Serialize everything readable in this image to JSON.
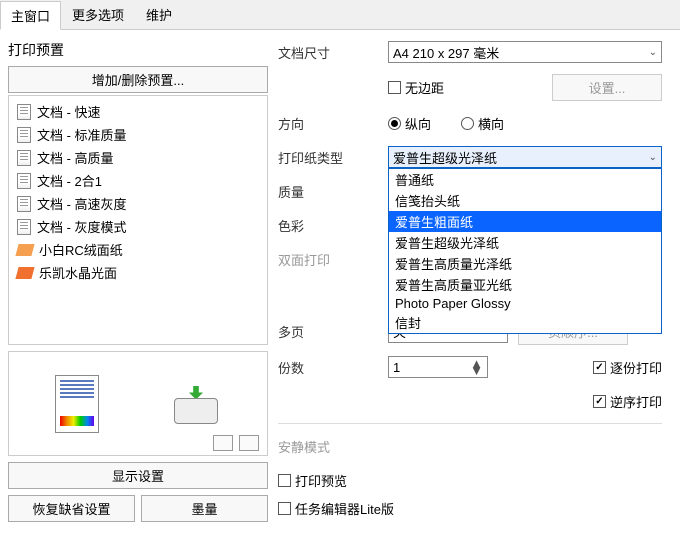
{
  "tabs": {
    "main": "主窗口",
    "more": "更多选项",
    "maint": "维护"
  },
  "left": {
    "title": "打印预置",
    "addremove": "增加/删除预置...",
    "presets": [
      "文档 - 快速",
      "文档 - 标准质量",
      "文档 - 高质量",
      "文档 - 2合1",
      "文档 - 高速灰度",
      "文档 - 灰度模式",
      "小白RC绒面纸",
      "乐凯水晶光面"
    ],
    "show_settings": "显示设置",
    "restore_defaults": "恢复缺省设置",
    "ink": "墨量"
  },
  "right": {
    "doc_size_label": "文档尺寸",
    "doc_size_value": "A4 210 x 297 毫米",
    "borderless": "无边距",
    "settings_btn": "设置...",
    "orientation_label": "方向",
    "orientation_portrait": "纵向",
    "orientation_landscape": "横向",
    "paper_type_label": "打印纸类型",
    "paper_type_value": "爱普生超级光泽纸",
    "paper_type_options": [
      "普通纸",
      "信笺抬头纸",
      "爱普生粗面纸",
      "爱普生超级光泽纸",
      "爱普生高质量光泽纸",
      "爱普生高质量亚光纸",
      "Photo Paper Glossy",
      "信封"
    ],
    "quality_label": "质量",
    "color_label": "色彩",
    "duplex_label": "双面打印",
    "multipage_label": "多页",
    "multipage_value": "关",
    "page_order": "页顺序...",
    "copies_label": "份数",
    "copies_value": "1",
    "collate": "逐份打印",
    "reverse": "逆序打印",
    "quiet_label": "安静模式",
    "print_preview": "打印预览",
    "task_editor": "任务编辑器Lite版"
  }
}
